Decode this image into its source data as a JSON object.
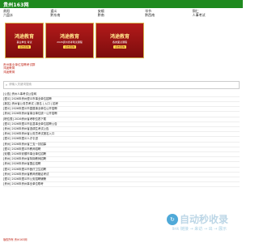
{
  "site": {
    "logo": "贵州163网"
  },
  "nav": [
    "贵阳",
    "遵义",
    "安顺",
    "毕节",
    "铜仁",
    "六盘水",
    "黔东南",
    "黔南",
    "黔西南",
    "人事考试"
  ],
  "banners": [
    {
      "title": "鸿途教育",
      "sub": "事业单位 考试",
      "cta": "点击咨询"
    },
    {
      "title": "鸿途教育",
      "sub": "2026贵州省考笔试课程",
      "cta": "点击咨询"
    },
    {
      "title": "鸿途教育",
      "sub": "各类面试课程",
      "cta": "点击咨询"
    }
  ],
  "links": [
    "贵州事业单位招聘考试群",
    "鸿途教育",
    "鸿途教育"
  ],
  "search": {
    "placeholder": "请输入关键词搜索"
  },
  "list": [
    "[公告] 贵州人事考试公告网",
    "[遵义] 2026年贵州遵义市事业单位招聘",
    "[报名] 贵州省公务员考试 | 报名 | 入口 | 招考",
    "[遵义] 2026年遵义市直属事业单位公开招聘",
    "[贵州] 2026年贵州省事业单位统一公开招聘",
    "[职位表] 2026贵州省考职位表下载",
    "[遵义] 2026年遵义市区县事业单位招聘公告",
    "[贵州] 2026年贵州省选调生考试公告",
    "[贵州] 2026年贵州省公务员考试报名入口",
    "[遵义] 2026年遵义人才引进",
    "[贵州] 2026年贵州省三支一扶招募",
    "[遵义] 2026年遵义市教师招聘",
    "[安顺] 2026年安顺市事业单位招聘",
    "[贵州] 2026年贵州省特岗教师招聘",
    "[贵州] 2026年贵州省国企招聘",
    "[遵义] 2026年遵义市医疗卫生招聘",
    "[贵州] 2026年贵州省教师资格证考试",
    "[遵义] 2026年遵义市公安招聘辅警",
    "[贵州] 2026年贵州事业单位联考"
  ],
  "watermark": {
    "text": "自动秒收录",
    "sub": "link 链接 → 来访 → 出 → 展示"
  },
  "footer": "版权所有 贵州163网"
}
